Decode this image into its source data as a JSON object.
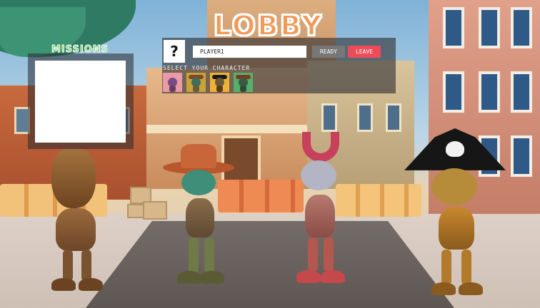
{
  "title": "LOBBY",
  "missions": {
    "title": "MISSIONS"
  },
  "player": {
    "avatar_placeholder": "?",
    "name": "PLAYER1"
  },
  "buttons": {
    "ready": "READY",
    "leave": "LEAVE"
  },
  "character_select": {
    "label": "SELECT YOUR CHARACTER",
    "options": [
      {
        "icon": "samurai-bot-icon",
        "tile_color": "#e89aa8"
      },
      {
        "icon": "cowboy-bot-icon",
        "tile_color": "#c9a23a"
      },
      {
        "icon": "pirate-bot-icon",
        "tile_color": "#f0b236"
      },
      {
        "icon": "explorer-bot-icon",
        "tile_color": "#55b16a"
      }
    ]
  },
  "colors": {
    "logo": "#f19a5a",
    "missions_title": "#7cd36b",
    "ready_button": "#777777",
    "leave_button": "#ee4b58"
  }
}
